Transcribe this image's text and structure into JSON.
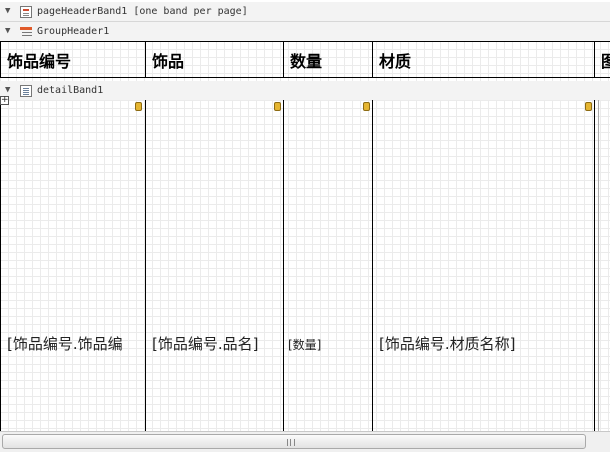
{
  "bands": {
    "page_header": {
      "label": "pageHeaderBand1 [one band per page]"
    },
    "group_header": {
      "label": "GroupHeader1"
    },
    "detail": {
      "label": "detailBand1"
    }
  },
  "header_cells": [
    "饰品编号",
    "饰品",
    "数量",
    "材质",
    "图"
  ],
  "detail_cells": [
    "[饰品编号.饰品编",
    "[饰品编号.品名]",
    "[数量]",
    "[饰品编号.材质名称]",
    ""
  ],
  "icons": {
    "collapse": "triangle-down-icon",
    "page_header": "page-header-band-icon",
    "group_header": "group-header-band-icon",
    "detail": "detail-band-icon",
    "smart_tag": "smart-tag-icon",
    "move": "move-handle-icon"
  },
  "colors": {
    "smart_tag": "#e5b531",
    "band_bar": "#f3f3f3",
    "grid": "#ebebeb"
  }
}
